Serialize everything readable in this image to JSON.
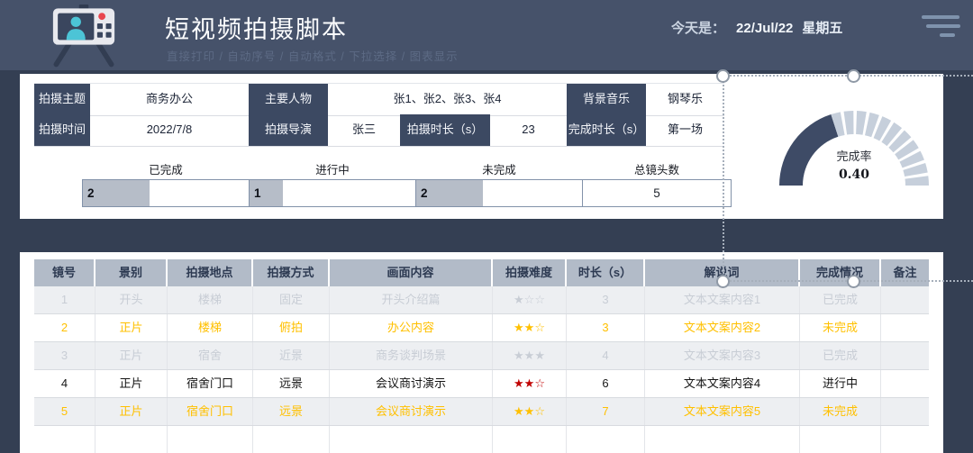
{
  "header": {
    "title": "短视频拍摄脚本",
    "subtitle": "直接打印 / 自动序号 / 自动格式 / 下拉选择 / 图表显示",
    "date_label": "今天是：",
    "date_value": "22/Jul/22",
    "weekday": "星期五"
  },
  "info": {
    "row1": [
      {
        "label": "拍摄主题",
        "value": "商务办公"
      },
      {
        "label": "主要人物",
        "value": "张1、张2、张3、张4"
      },
      {
        "label": "背景音乐",
        "value": "钢琴乐"
      }
    ],
    "row2": [
      {
        "label": "拍摄时间",
        "value": "2022/7/8"
      },
      {
        "label": "拍摄导演",
        "value": "张三"
      },
      {
        "label": "拍摄时长（s）",
        "value": "23"
      },
      {
        "label": "完成时长（s）",
        "value": "第一场"
      }
    ]
  },
  "stats": {
    "bar_max": 5,
    "items": [
      {
        "label": "已完成",
        "value": "2",
        "bar": true
      },
      {
        "label": "进行中",
        "value": "1",
        "bar": true
      },
      {
        "label": "未完成",
        "value": "2",
        "bar": true
      },
      {
        "label": "总镜头数",
        "value": "5",
        "bar": false
      }
    ]
  },
  "chart_data": {
    "type": "gauge",
    "title": "完成率",
    "value": 0.4,
    "value_label": "0.40",
    "min": 0,
    "max": 1,
    "segments_remaining": 11,
    "colors": {
      "filled": "#3e4b66",
      "remaining": "#c6cfdb"
    }
  },
  "table": {
    "columns": [
      "镜号",
      "景别",
      "拍摄地点",
      "拍摄方式",
      "画面内容",
      "拍摄难度",
      "时长（s）",
      "解说词",
      "完成情况",
      "备注"
    ],
    "rows": [
      {
        "status": "done",
        "cells": [
          "1",
          "开头",
          "楼梯",
          "固定",
          "开头介绍篇",
          "★☆☆",
          "3",
          "文本文案内容1",
          "已完成",
          ""
        ]
      },
      {
        "status": "pending",
        "cells": [
          "2",
          "正片",
          "楼梯",
          "俯拍",
          "办公内容",
          "★★☆",
          "3",
          "文本文案内容2",
          "未完成",
          ""
        ]
      },
      {
        "status": "done",
        "cells": [
          "3",
          "正片",
          "宿舍",
          "近景",
          "商务谈判场景",
          "★★★",
          "4",
          "文本文案内容3",
          "已完成",
          ""
        ]
      },
      {
        "status": "active",
        "star_color": "#C00000",
        "cells": [
          "4",
          "正片",
          "宿舍门口",
          "远景",
          "会议商讨演示",
          "★★☆",
          "6",
          "文本文案内容4",
          "进行中",
          ""
        ]
      },
      {
        "status": "pending",
        "cells": [
          "5",
          "正片",
          "宿舍门口",
          "远景",
          "会议商讨演示",
          "★★☆",
          "7",
          "文本文案内容5",
          "未完成",
          ""
        ]
      },
      {
        "status": "empty",
        "cells": [
          "",
          "",
          "",
          "",
          "",
          "",
          "",
          "",
          "",
          ""
        ]
      }
    ]
  },
  "colors": {
    "accent_orange": "#FFC000",
    "navy_label": "#3C4962",
    "star_red": "#C00000",
    "header_band": "#46526A",
    "content_bg": "#343F53"
  }
}
